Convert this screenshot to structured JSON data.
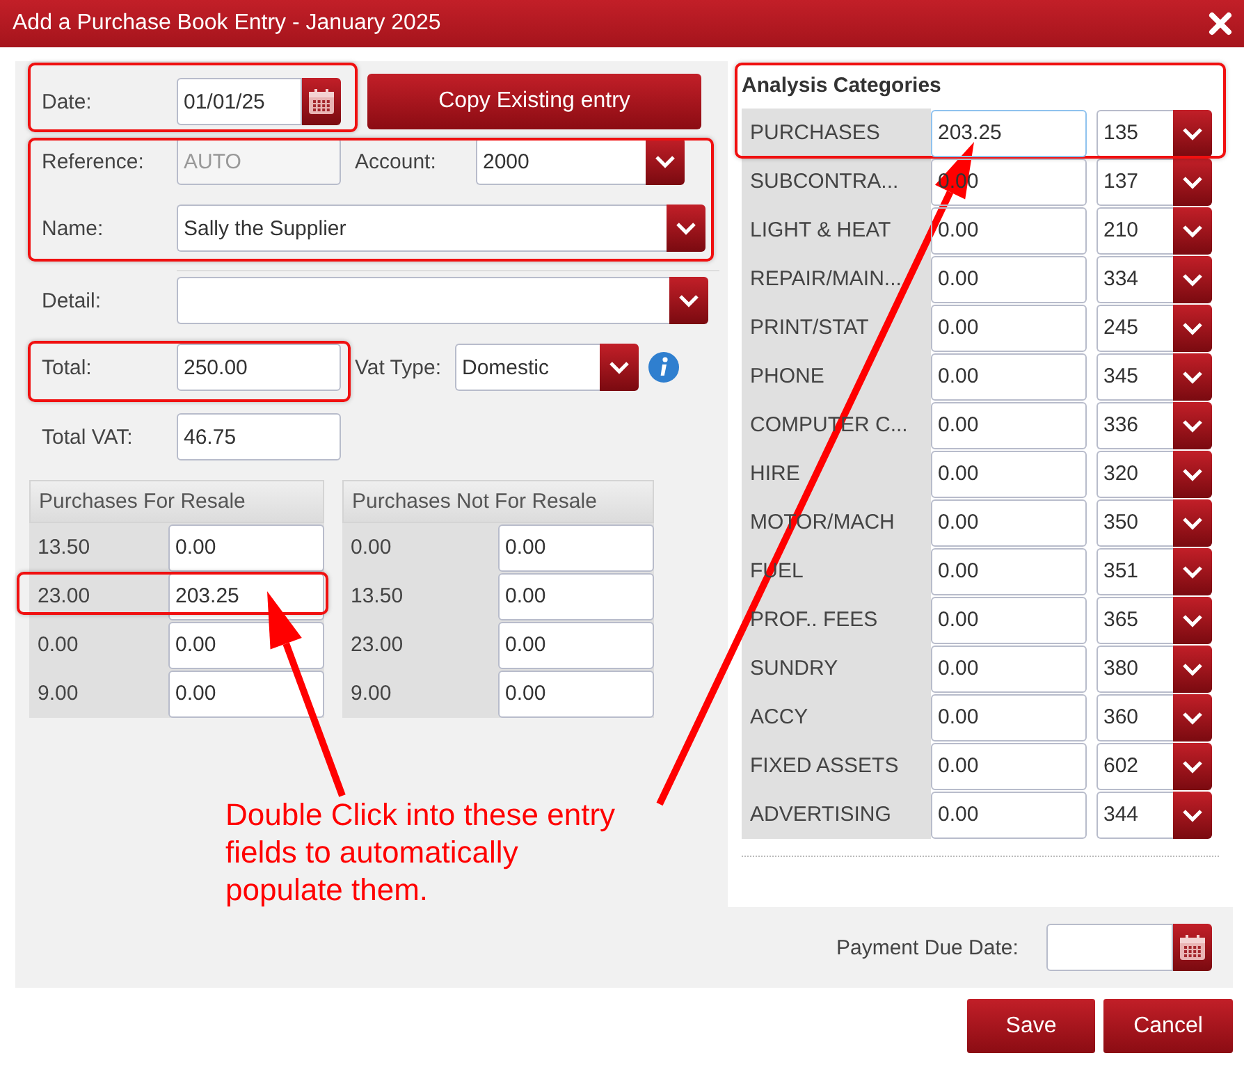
{
  "window": {
    "title": "Add a Purchase Book Entry - January 2025"
  },
  "form": {
    "date": {
      "label": "Date:",
      "value": "01/01/25"
    },
    "copy_button": "Copy Existing entry",
    "reference": {
      "label": "Reference:",
      "value": "AUTO",
      "disabled": true
    },
    "account": {
      "label": "Account:",
      "value": "2000"
    },
    "name": {
      "label": "Name:",
      "value": "Sally the Supplier"
    },
    "detail": {
      "label": "Detail:"
    },
    "total": {
      "label": "Total:",
      "value": "250.00"
    },
    "vat_type": {
      "label": "Vat Type:",
      "value": "Domestic"
    },
    "total_vat": {
      "label": "Total VAT:",
      "value": "46.75"
    }
  },
  "resale_tables": [
    {
      "title": "Purchases For Resale",
      "rows": [
        {
          "rate": "13.50",
          "amount": "0.00"
        },
        {
          "rate": "23.00",
          "amount": "203.25"
        },
        {
          "rate": "0.00",
          "amount": "0.00"
        },
        {
          "rate": "9.00",
          "amount": "0.00"
        }
      ]
    },
    {
      "title": "Purchases Not For Resale",
      "rows": [
        {
          "rate": "0.00",
          "amount": "0.00"
        },
        {
          "rate": "13.50",
          "amount": "0.00"
        },
        {
          "rate": "23.00",
          "amount": "0.00"
        },
        {
          "rate": "9.00",
          "amount": "0.00"
        }
      ]
    }
  ],
  "analysis": {
    "title": "Analysis Categories",
    "rows": [
      {
        "name": "PURCHASES",
        "amount": "203.25",
        "code": "135",
        "focused": true
      },
      {
        "name": "SUBCONTRA...",
        "amount": "0.00",
        "code": "137",
        "focused": false
      },
      {
        "name": "LIGHT & HEAT",
        "amount": "0.00",
        "code": "210",
        "focused": false
      },
      {
        "name": "REPAIR/MAIN...",
        "amount": "0.00",
        "code": "334",
        "focused": false
      },
      {
        "name": "PRINT/STAT",
        "amount": "0.00",
        "code": "245",
        "focused": false
      },
      {
        "name": "PHONE",
        "amount": "0.00",
        "code": "345",
        "focused": false
      },
      {
        "name": "COMPUTER C...",
        "amount": "0.00",
        "code": "336",
        "focused": false
      },
      {
        "name": "HIRE",
        "amount": "0.00",
        "code": "320",
        "focused": false
      },
      {
        "name": "MOTOR/MACH",
        "amount": "0.00",
        "code": "350",
        "focused": false
      },
      {
        "name": "FUEL",
        "amount": "0.00",
        "code": "351",
        "focused": false
      },
      {
        "name": "PROF.. FEES",
        "amount": "0.00",
        "code": "365",
        "focused": false
      },
      {
        "name": "SUNDRY",
        "amount": "0.00",
        "code": "380",
        "focused": false
      },
      {
        "name": "ACCY",
        "amount": "0.00",
        "code": "360",
        "focused": false
      },
      {
        "name": "FIXED ASSETS",
        "amount": "0.00",
        "code": "602",
        "focused": false
      },
      {
        "name": "ADVERTISING",
        "amount": "0.00",
        "code": "344",
        "focused": false
      }
    ]
  },
  "payment_due": {
    "label": "Payment Due Date:"
  },
  "buttons": [
    "Save",
    "Cancel"
  ],
  "annotation": {
    "text": "Double Click into these entry fields to automatically populate them."
  }
}
